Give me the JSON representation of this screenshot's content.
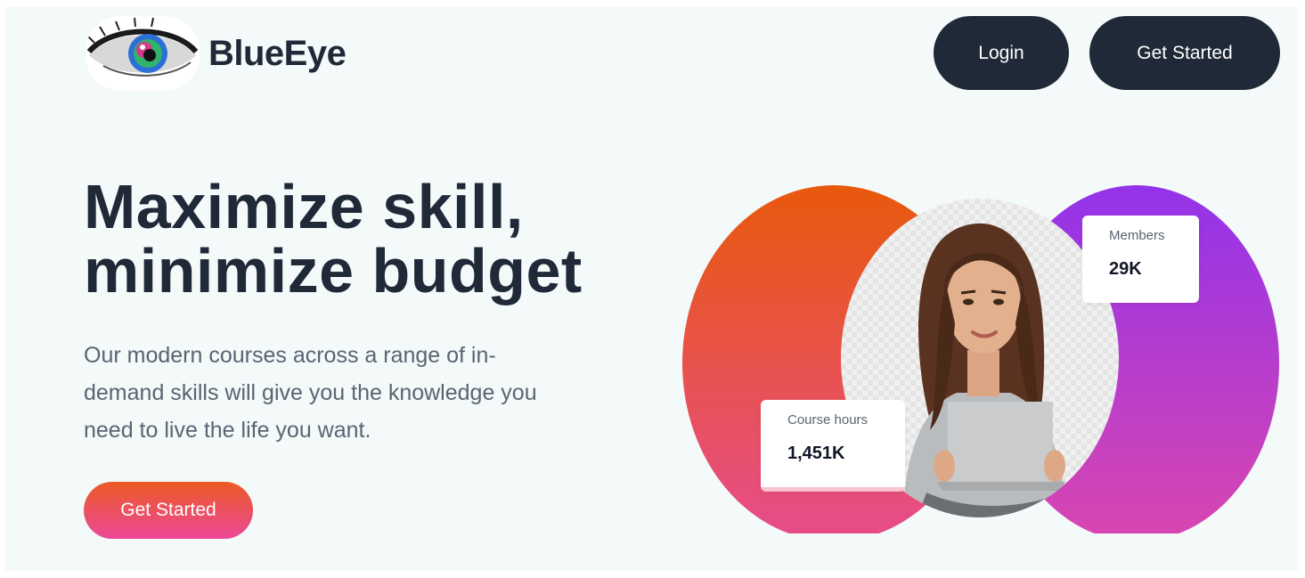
{
  "brand": {
    "name": "BlueEye"
  },
  "nav": {
    "login_label": "Login",
    "get_started_label": "Get Started"
  },
  "hero": {
    "title_lines": [
      "Maximize skill,",
      "minimize budget"
    ],
    "description_lines": [
      "Our modern courses across a range of in-",
      "demand skills will give you the knowledge you",
      "need to live the life you want."
    ],
    "cta_label": "Get Started"
  },
  "stats": {
    "members": {
      "label": "Members",
      "value": "29K"
    },
    "course_hours": {
      "label": "Course hours",
      "value": "1,451K"
    }
  },
  "colors": {
    "dark": "#1f2937",
    "orange": "#e8590c",
    "pink": "#ec4899",
    "purple": "#9333ea",
    "background": "#f4f9f9"
  }
}
